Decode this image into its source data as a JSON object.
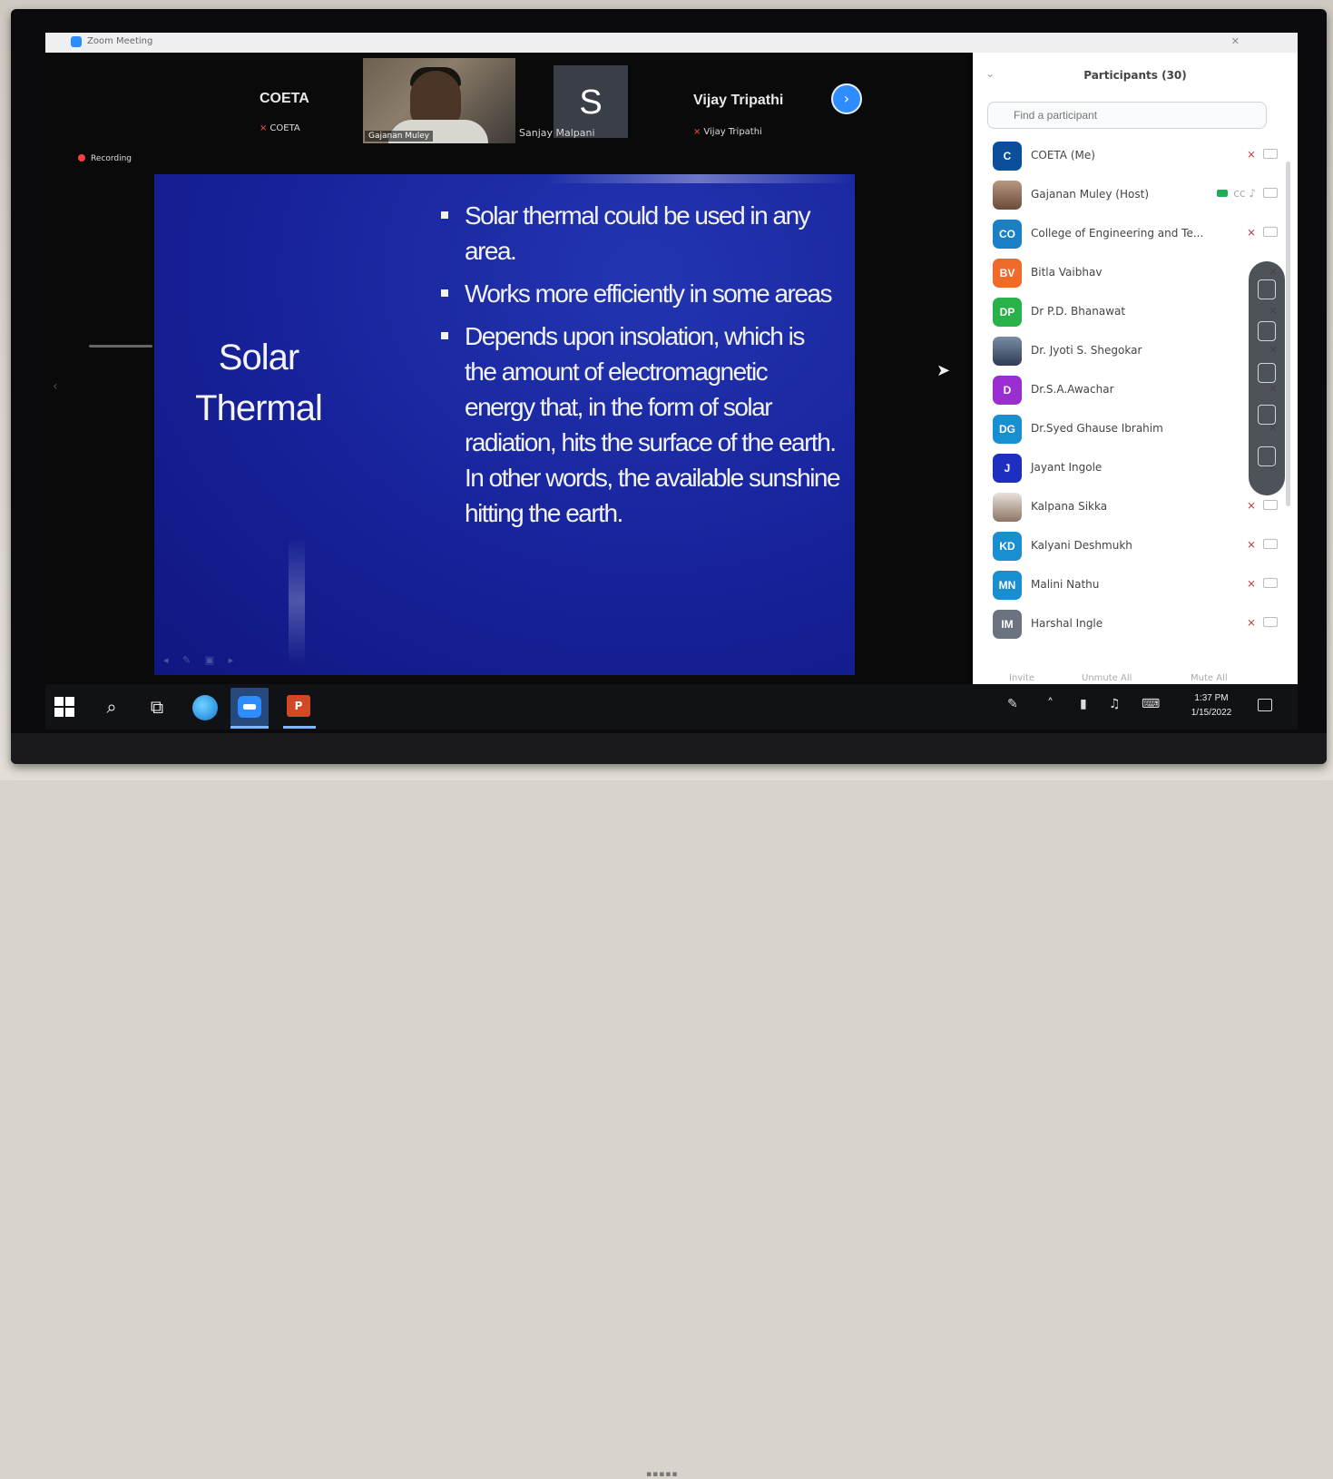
{
  "window": {
    "title": "Zoom Meeting"
  },
  "gallery": {
    "tiles": [
      {
        "display": "COETA",
        "name": "COETA"
      },
      {
        "name": "Gajanan Muley"
      },
      {
        "initial": "S",
        "name": "Sanjay Malpani"
      },
      {
        "display": "Vijay Tripathi",
        "name": "Vijay Tripathi"
      }
    ],
    "recording_label": "Recording"
  },
  "slide": {
    "title_line1": "Solar",
    "title_line2": "Thermal",
    "bullets": [
      "Solar thermal could be used in any area.",
      "Works more efficiently in some areas",
      "Depends upon insolation, which is the amount of electromagnetic energy that, in the form of solar radiation, hits the surface of the earth. In other words, the available sunshine hitting the earth."
    ]
  },
  "participants_panel": {
    "title": "Participants (30)",
    "search_placeholder": "Find a participant",
    "items": [
      {
        "initials": "C",
        "color": "#0b4f9c",
        "name": "COETA (Me)"
      },
      {
        "initials": "",
        "color": "#c94a4a",
        "name": "Gajanan Muley (Host)"
      },
      {
        "initials": "CO",
        "color": "#1a7fc4",
        "name": "College of Engineering and Te..."
      },
      {
        "initials": "BV",
        "color": "#f06a2a",
        "name": "Bitla Vaibhav"
      },
      {
        "initials": "DP",
        "color": "#27b24a",
        "name": "Dr P.D. Bhanawat"
      },
      {
        "initials": "",
        "color": "#6a7f99",
        "name": "Dr. Jyoti S. Shegokar"
      },
      {
        "initials": "D",
        "color": "#9b2ed1",
        "name": "Dr.S.A.Awachar"
      },
      {
        "initials": "DG",
        "color": "#1a8fd0",
        "name": "Dr.Syed Ghause Ibrahim"
      },
      {
        "initials": "J",
        "color": "#1e2fc0",
        "name": "Jayant Ingole"
      },
      {
        "initials": "",
        "color": "#a58a78",
        "name": "Kalpana Sikka"
      },
      {
        "initials": "KD",
        "color": "#1a8fd0",
        "name": "Kalyani Deshmukh"
      },
      {
        "initials": "MN",
        "color": "#1a8fd0",
        "name": "Malini Nathu"
      },
      {
        "initials": "IM",
        "color": "#6b7280",
        "name": "Harshal Ingle"
      }
    ],
    "footer": {
      "invite": "Invite",
      "unmute_all": "Unmute All",
      "mute_all": "Mute All"
    }
  },
  "taskbar": {
    "time": "1:37 PM",
    "date": "1/15/2022"
  }
}
